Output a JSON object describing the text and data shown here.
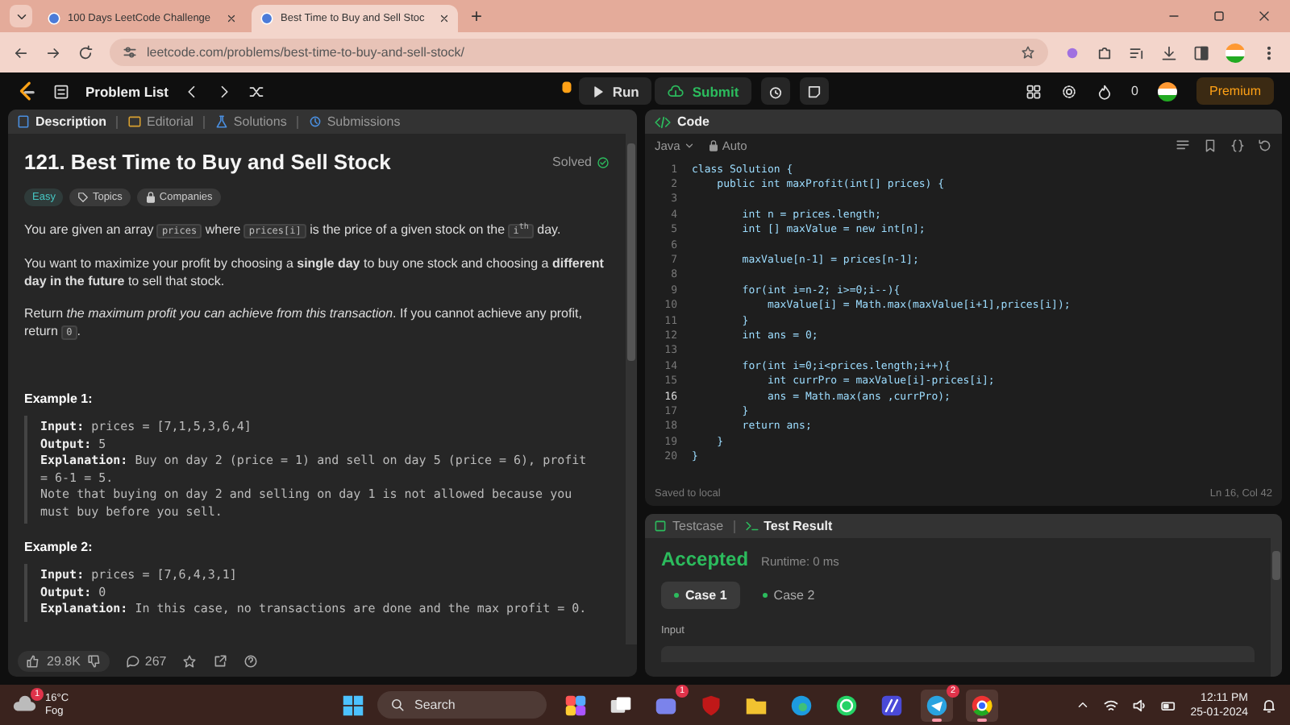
{
  "browser": {
    "tabs": [
      {
        "title": "100 Days LeetCode Challenge",
        "selected": false
      },
      {
        "title": "Best Time to Buy and Sell Stoc",
        "selected": true
      }
    ],
    "new_tab": "+",
    "url": "leetcode.com/problems/best-time-to-buy-and-sell-stock/"
  },
  "nav": {
    "problem_list": "Problem List",
    "run": "Run",
    "submit": "Submit",
    "streak": "0",
    "premium": "Premium"
  },
  "description_panel": {
    "tabs": [
      {
        "label": "Description",
        "selected": true
      },
      {
        "label": "Editorial",
        "selected": false
      },
      {
        "label": "Solutions",
        "selected": false
      },
      {
        "label": "Submissions",
        "selected": false
      }
    ],
    "title": "121. Best Time to Buy and Sell Stock",
    "status": "Solved",
    "tags": [
      {
        "label": "Easy",
        "kind": "difficulty"
      },
      {
        "label": "Topics",
        "kind": "topics"
      },
      {
        "label": "Companies",
        "kind": "companies"
      }
    ],
    "paragraphs": [
      [
        {
          "kind": "text",
          "text": "You are given an array "
        },
        {
          "kind": "code",
          "text": "prices"
        },
        {
          "kind": "text",
          "text": " where "
        },
        {
          "kind": "code",
          "text": "prices[i]"
        },
        {
          "kind": "text",
          "text": " is the price of a given stock on the "
        },
        {
          "kind": "code",
          "text": "i$^{th}$"
        },
        {
          "kind": "text",
          "text": " day."
        }
      ],
      [
        {
          "kind": "text",
          "text": "You want to maximize your profit by choosing a **single day** to buy one stock and choosing a **different day in the future** to sell that stock."
        }
      ],
      [
        {
          "kind": "text",
          "text": "Return *the maximum profit you can achieve from this transaction*. If you cannot achieve any profit, return "
        },
        {
          "kind": "code",
          "text": "0"
        },
        {
          "kind": "text",
          "text": "."
        }
      ]
    ],
    "examples": [
      {
        "heading": "Example 1:",
        "lines": [
          {
            "label": "Input:",
            "text": "prices = [7,1,5,3,6,4]"
          },
          {
            "label": "Output:",
            "text": "5"
          },
          {
            "label": "Explanation:",
            "text": "Buy on day 2 (price = 1) and sell on day 5 (price = 6), profit = 6-1 = 5."
          },
          {
            "text": "Note that buying on day 2 and selling on day 1 is not allowed because you must buy before you sell."
          }
        ]
      },
      {
        "heading": "Example 2:",
        "lines": [
          {
            "label": "Input:",
            "text": "prices = [7,6,4,3,1]"
          },
          {
            "label": "Output:",
            "text": "0"
          },
          {
            "label": "Explanation:",
            "text": "In this case, no transactions are done and the max profit = 0."
          }
        ]
      }
    ],
    "footer": {
      "likes": "29.8K",
      "comments": "267"
    }
  },
  "code_panel": {
    "title": "Code",
    "language": "Java",
    "mode": "Auto",
    "saved": "Saved to local",
    "cursor": "Ln 16, Col 42",
    "lines": [
      {
        "n": "1",
        "code": "class Solution {",
        "current": false
      },
      {
        "n": "2",
        "code": "    public int maxProfit(int[] prices) {",
        "current": false
      },
      {
        "n": "3",
        "current": false
      },
      {
        "n": "4",
        "code": "        int n = prices.length;",
        "current": false
      },
      {
        "n": "5",
        "code": "        int [] maxValue = new int[n];",
        "current": false
      },
      {
        "n": "6",
        "current": false
      },
      {
        "n": "7",
        "code": "        maxValue[n-1] = prices[n-1];",
        "current": false
      },
      {
        "n": "8",
        "current": false
      },
      {
        "n": "9",
        "code": "        for(int i=n-2; i>=0;i--){",
        "current": false
      },
      {
        "n": "10",
        "code": "            maxValue[i] = Math.max(maxValue[i+1],prices[i]);",
        "current": false
      },
      {
        "n": "11",
        "code": "        }",
        "current": false
      },
      {
        "n": "12",
        "code": "        int ans = 0;",
        "current": false
      },
      {
        "n": "13",
        "current": false
      },
      {
        "n": "14",
        "code": "        for(int i=0;i<prices.length;i++){",
        "current": false
      },
      {
        "n": "15",
        "code": "            int currPro = maxValue[i]-prices[i];",
        "current": false
      },
      {
        "n": "16",
        "code": "            ans = Math.max(ans ,currPro);",
        "current": true
      },
      {
        "n": "17",
        "code": "        }",
        "current": false
      },
      {
        "n": "18",
        "code": "        return ans;",
        "current": false
      },
      {
        "n": "19",
        "code": "    }",
        "current": false
      },
      {
        "n": "20",
        "code": "}",
        "current": false
      }
    ]
  },
  "result_panel": {
    "tabs": [
      {
        "label": "Testcase",
        "selected": false
      },
      {
        "label": "Test Result",
        "selected": true
      }
    ],
    "verdict": "Accepted",
    "runtime": "Runtime: 0 ms",
    "cases": [
      {
        "label": "Case 1",
        "selected": true
      },
      {
        "label": "Case 2",
        "selected": false
      }
    ],
    "input_label": "Input"
  },
  "taskbar": {
    "weather": {
      "temp": "16°C",
      "condition": "Fog",
      "badge": "1"
    },
    "search_placeholder": "Search",
    "apps": [
      {
        "kind": "copilot",
        "active": false
      },
      {
        "kind": "taskview",
        "active": false
      },
      {
        "kind": "teams",
        "badge": "1",
        "active": false
      },
      {
        "kind": "shield",
        "active": false
      },
      {
        "kind": "folder",
        "active": false
      },
      {
        "kind": "edge",
        "active": false
      },
      {
        "kind": "whatsapp",
        "active": false
      },
      {
        "kind": "editor",
        "active": false
      },
      {
        "kind": "telegram",
        "badge": "2",
        "active": true
      },
      {
        "kind": "chrome",
        "active": true
      }
    ],
    "time": "12:11 PM",
    "date": "25-01-2024"
  }
}
